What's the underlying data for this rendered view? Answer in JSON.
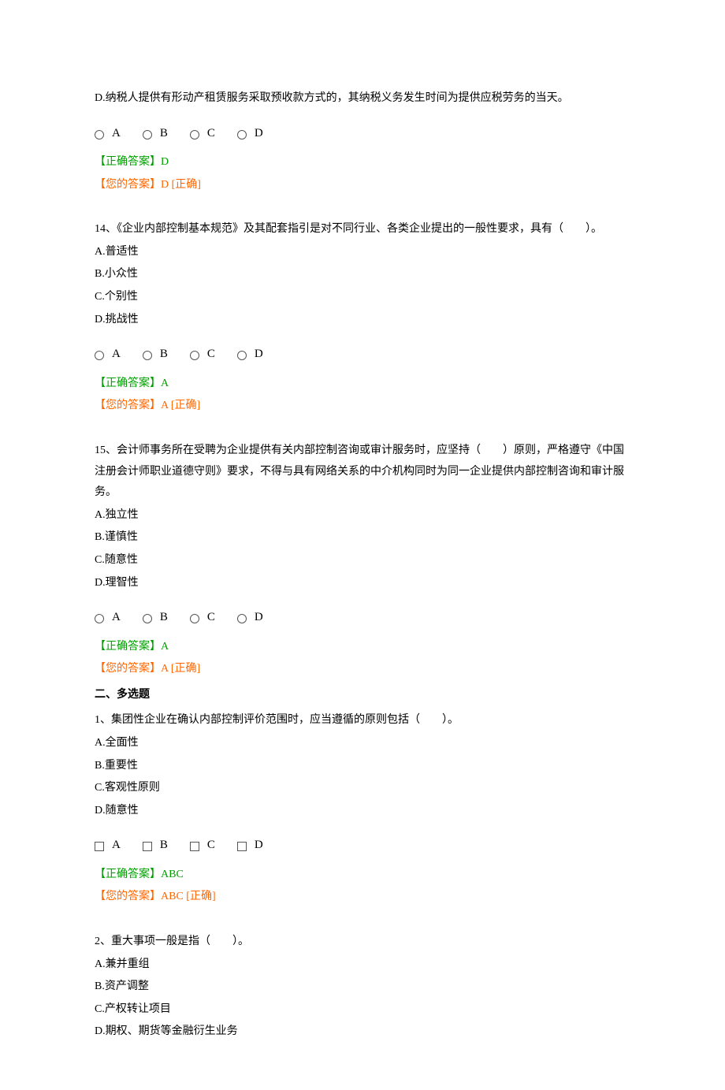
{
  "q13": {
    "optD": "D.纳税人提供有形动产租赁服务采取预收款方式的，其纳税义务发生时间为提供应税劳务的当天。",
    "choices": [
      "A",
      "B",
      "C",
      "D"
    ],
    "correct": "【正确答案】D",
    "your": "【您的答案】D   [正确]"
  },
  "q14": {
    "stem": "14、《企业内部控制基本规范》及其配套指引是对不同行业、各类企业提出的一般性要求，具有（　　）。",
    "optA": "A.普适性",
    "optB": "B.小众性",
    "optC": "C.个别性",
    "optD": "D.挑战性",
    "choices": [
      "A",
      "B",
      "C",
      "D"
    ],
    "correct": "【正确答案】A",
    "your": "【您的答案】A   [正确]"
  },
  "q15": {
    "stem": "15、会计师事务所在受聘为企业提供有关内部控制咨询或审计服务时，应坚持（　　）原则，严格遵守《中国注册会计师职业道德守则》要求，不得与具有网络关系的中介机构同时为同一企业提供内部控制咨询和审计服务。",
    "optA": "A.独立性",
    "optB": "B.谨慎性",
    "optC": "C.随意性",
    "optD": "D.理智性",
    "choices": [
      "A",
      "B",
      "C",
      "D"
    ],
    "correct": "【正确答案】A",
    "your": "【您的答案】A   [正确]"
  },
  "section2": "二、多选题",
  "m1": {
    "stem": "1、集团性企业在确认内部控制评价范围时，应当遵循的原则包括（　　）。",
    "optA": "A.全面性",
    "optB": "B.重要性",
    "optC": "C.客观性原则",
    "optD": "D.随意性",
    "choices": [
      "A",
      "B",
      "C",
      "D"
    ],
    "correct": "【正确答案】ABC",
    "your": "【您的答案】ABC   [正确]"
  },
  "m2": {
    "stem": "2、重大事项一般是指（　　）。",
    "optA": "A.兼并重组",
    "optB": "B.资产调整",
    "optC": "C.产权转让项目",
    "optD": "D.期权、期货等金融衍生业务"
  }
}
